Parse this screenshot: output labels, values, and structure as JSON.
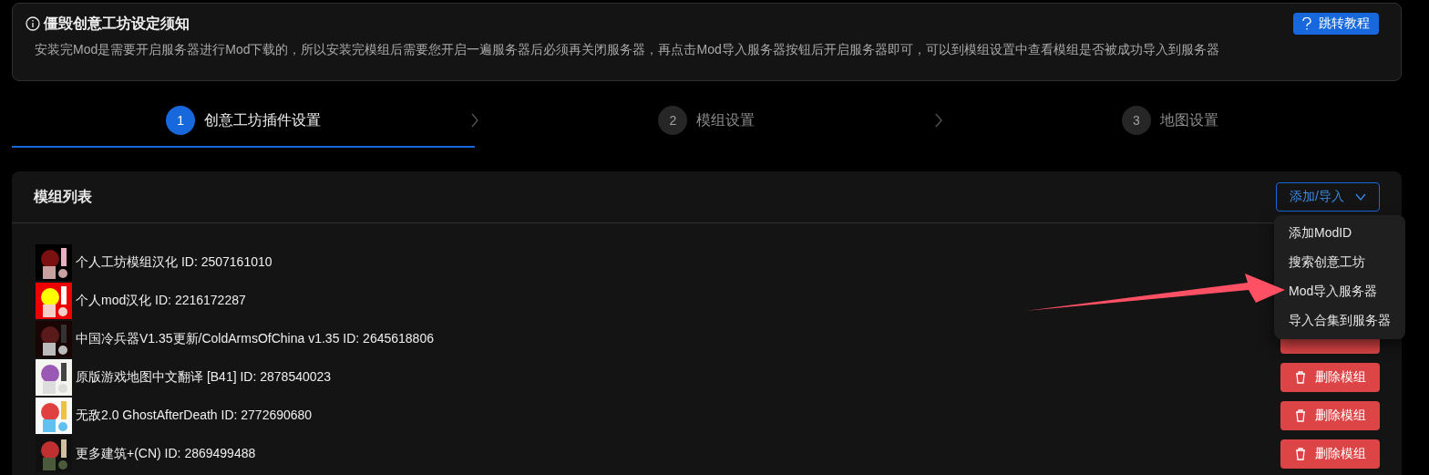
{
  "notice": {
    "title": "僵毁创意工坊设定须知",
    "text": "安装完Mod是需要开启服务器进行Mod下载的，所以安装完模组后需要您开启一遍服务器后必须再关闭服务器，再点击Mod导入服务器按钮后开启服务器即可，可以到模组设置中查看模组是否被成功导入到服务器",
    "button": "跳转教程"
  },
  "steps": [
    {
      "number": "1",
      "label": "创意工坊插件设置",
      "selected": true
    },
    {
      "number": "2",
      "label": "模组设置",
      "selected": false
    },
    {
      "number": "3",
      "label": "地图设置",
      "selected": false
    }
  ],
  "mod_list": {
    "title": "模组列表",
    "add_button": "添加/导入",
    "menu": [
      "添加ModID",
      "搜索创意工坊",
      "Mod导入服务器",
      "导入合集到服务器"
    ],
    "rows": [
      {
        "name": "个人工坊模组汉化 ID: 2507161010",
        "kind": "hidden"
      },
      {
        "name": "个人mod汉化 ID: 2216172287",
        "kind": "hidden"
      },
      {
        "name": "中国冷兵器V1.35更新/ColdArmsOfChina v1.35 ID: 2645618806",
        "kind": "covered"
      },
      {
        "name": "原版游戏地图中文翻译 [B41] ID: 2878540023",
        "delete_button": "删除模组"
      },
      {
        "name": "无敌2.0 GhostAfterDeath ID: 2772690680",
        "delete_button": "删除模组"
      },
      {
        "name": "更多建筑+(CN) ID: 2869499488",
        "delete_button": "删除模组"
      }
    ]
  }
}
